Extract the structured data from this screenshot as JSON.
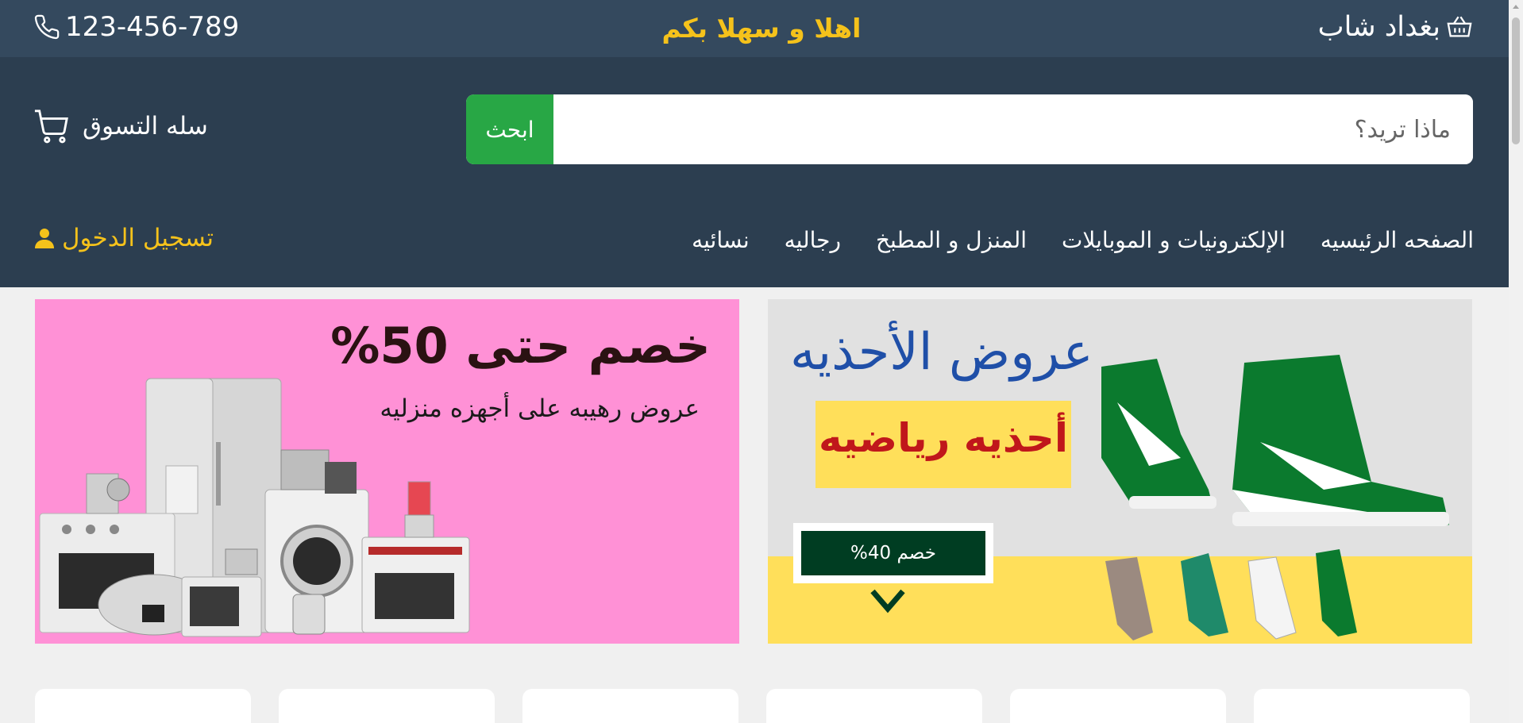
{
  "topbar": {
    "phone": "123-456-789",
    "welcome": "اهلا و سهلا بكم",
    "brand": "بغداد شاب",
    "phone_icon": "phone-icon",
    "brand_icon": "basket-icon"
  },
  "header": {
    "search_placeholder": "ماذا تريد؟",
    "search_button": "ابحث",
    "cart_label": "سله التسوق",
    "cart_icon": "cart-icon",
    "login_label": "تسجيل الدخول",
    "login_icon": "user-icon",
    "nav": [
      "الصفحه الرئيسيه",
      "الإلكترونيات و الموبايلات",
      "المنزل و المطبخ",
      "رجاليه",
      "نسائيه"
    ]
  },
  "banners": {
    "left": {
      "title": "خصم حتى 50%",
      "subtitle": "عروض رهيبه على  أجهزه منزليه"
    },
    "right": {
      "title": "عروض الأحذيه",
      "box_text": "أحذيه رياضيه",
      "tag_text": "خصم 40%"
    }
  },
  "colors": {
    "topbar_bg": "#34495e",
    "header_bg": "#2c3e50",
    "accent_yellow": "#f5c21b",
    "search_button": "#28a745",
    "left_banner_bg": "#ff91d6",
    "shoe_green": "#0b7a2e"
  }
}
